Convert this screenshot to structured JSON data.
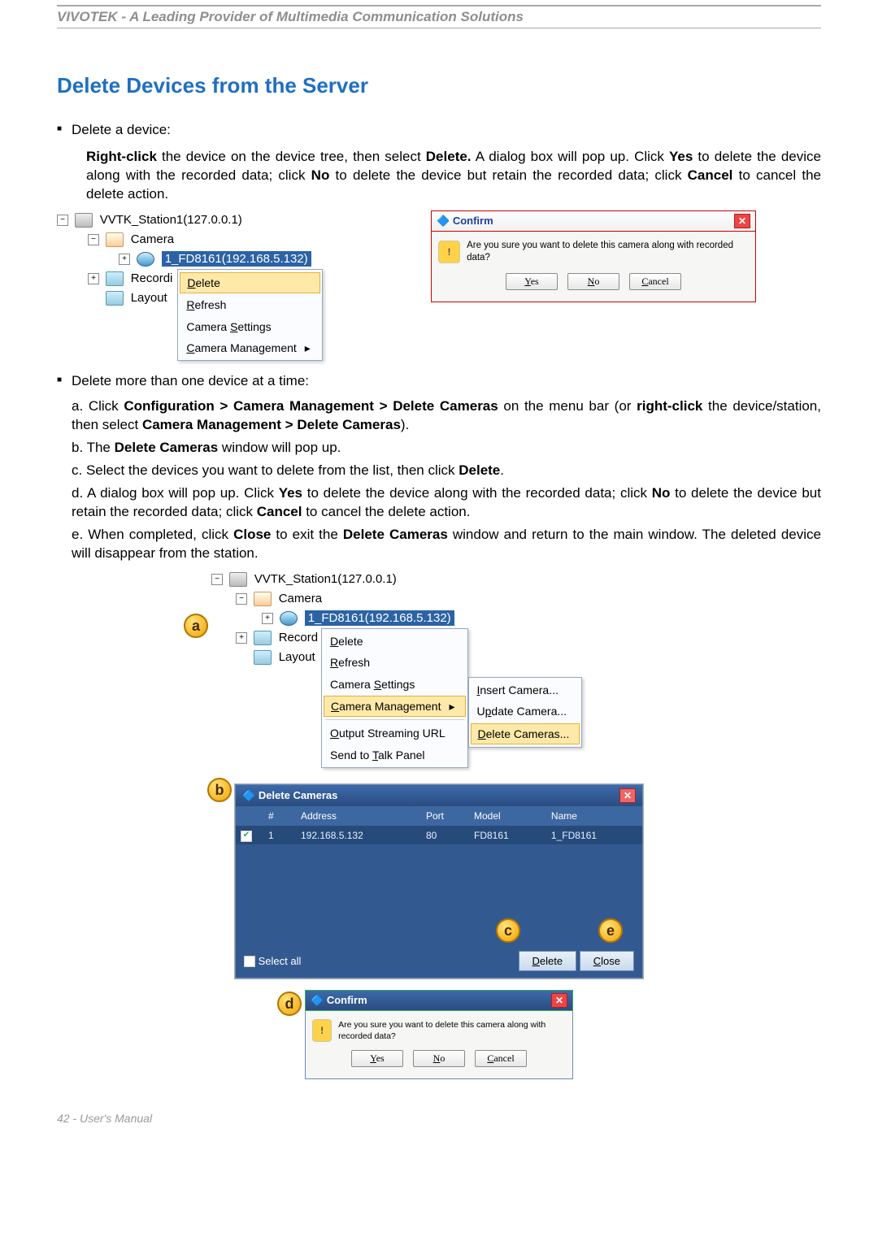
{
  "header": "VIVOTEK - A Leading Provider of Multimedia Communication Solutions",
  "title": "Delete Devices from the Server",
  "bullet1_lead": "Delete a device:",
  "bullet1_body_parts": {
    "p1a": "Right-click",
    "p1b": " the device on the device tree, then select ",
    "p1c": "Delete.",
    "p1d": " A dialog box will pop up. Click ",
    "p1e": "Yes",
    "p1f": " to delete the device along with the recorded data; click ",
    "p1g": "No",
    "p1h": " to delete the device but retain the recorded data; click ",
    "p1i": "Cancel",
    "p1j": " to cancel the delete action."
  },
  "tree1": {
    "station": "VVTK_Station1(127.0.0.1)",
    "camera_group": "Camera",
    "camera_item": "1_FD8161(192.168.5.132)",
    "recording": "Recordi",
    "layout": "Layout"
  },
  "menu1": {
    "delete": "Delete",
    "refresh": "Refresh",
    "settings": "Camera Settings",
    "management": "Camera Management"
  },
  "confirm": {
    "title": "Confirm",
    "msg": "Are you sure you want to delete this camera along with recorded data?",
    "yes": "Yes",
    "no": "No",
    "cancel": "Cancel"
  },
  "bullet2_lead": "Delete more than one device at a time:",
  "steps": {
    "a1": "a. Click ",
    "a2": "Configuration > Camera Management > Delete Cameras",
    "a3": " on the menu bar (or ",
    "a4": "right-click",
    "a5": " the device/station, then select ",
    "a6": "Camera Management > Delete Cameras",
    "a7": ").",
    "b1": "b. The ",
    "b2": "Delete Cameras",
    "b3": " window will pop up.",
    "c1": "c. Select the devices you want to delete from the list, then click ",
    "c2": "Delete",
    "c3": ".",
    "d1": "d. A dialog box will pop up. Click ",
    "d2": "Yes",
    "d3": " to delete the device along with the recorded data; click ",
    "d4": "No",
    "d5": " to delete the device but retain the recorded data; click ",
    "d6": "Cancel",
    "d7": " to cancel the delete action.",
    "e1": "e. When completed, click ",
    "e2": "Close",
    "e3": " to exit the ",
    "e4": "Delete Cameras",
    "e5": " window and return to the main window. The deleted device will disappear from the station."
  },
  "tree2": {
    "station": "VVTK_Station1(127.0.0.1)",
    "camera_group": "Camera",
    "camera_item": "1_FD8161(192.168.5.132)",
    "recording": "Record",
    "layout": "Layout"
  },
  "menu2": {
    "delete": "Delete",
    "refresh": "Refresh",
    "settings": "Camera Settings",
    "management": "Camera Management",
    "output": "Output Streaming URL",
    "talk": "Send to Talk Panel"
  },
  "submenu": {
    "insert": "Insert Camera...",
    "update": "Update Camera...",
    "delete": "Delete Cameras..."
  },
  "delcam": {
    "title": "Delete Cameras",
    "cols": {
      "num": "#",
      "addr": "Address",
      "port": "Port",
      "model": "Model",
      "name": "Name"
    },
    "row": {
      "num": "1",
      "addr": "192.168.5.132",
      "port": "80",
      "model": "FD8161",
      "name": "1_FD8161"
    },
    "selectall": "Select all",
    "delete_btn": "Delete",
    "close_btn": "Close"
  },
  "badges": {
    "a": "a",
    "b": "b",
    "c": "c",
    "d": "d",
    "e": "e"
  },
  "footer": "42 - User's Manual"
}
